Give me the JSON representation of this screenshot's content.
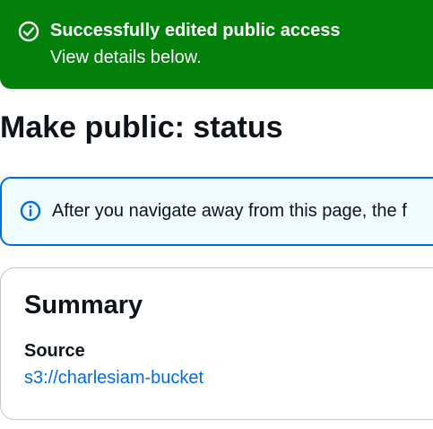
{
  "flashbar": {
    "title": "Successfully edited public access",
    "subtitle": "View details below.",
    "icon": "success-check-circle-icon",
    "color": "#037f0c"
  },
  "page": {
    "title": "Make public: status"
  },
  "info_alert": {
    "icon": "info-icon",
    "text": "After you navigate away from this page, the f",
    "border_color": "#006ce0",
    "background": "#f0fbff"
  },
  "summary": {
    "title": "Summary",
    "source_label": "Source",
    "source_value": "s3://charlesiam-bucket",
    "link_color": "#006ce0"
  }
}
